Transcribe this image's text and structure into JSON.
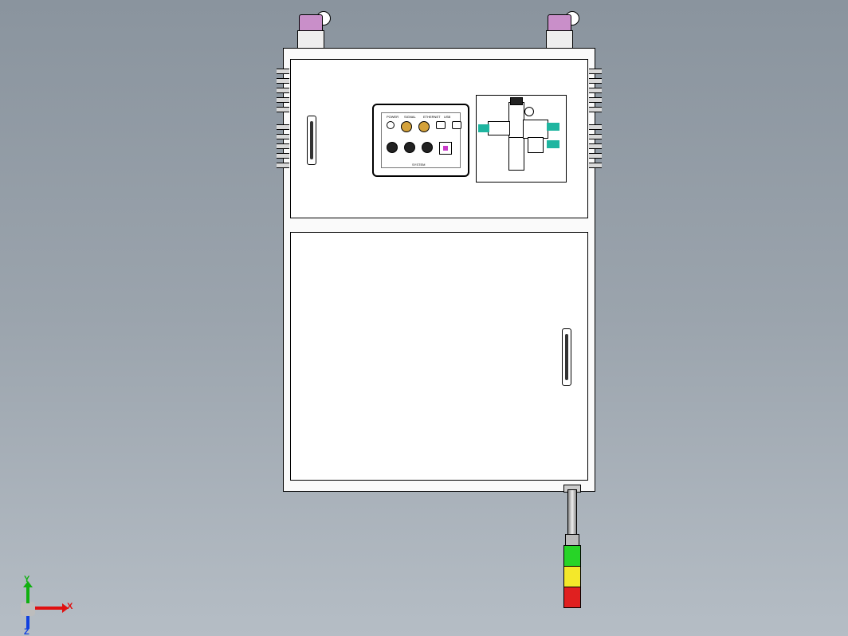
{
  "axes": {
    "x": "X",
    "y": "Y",
    "z": "Z"
  },
  "control_panel": {
    "row1_labels": [
      "POWER",
      "SIGNAL",
      "ETHERNET",
      "USB"
    ],
    "bottom_label": "SYSTEM"
  },
  "signal_tower": {
    "colors": [
      "#27d427",
      "#f4e82a",
      "#e02020"
    ]
  },
  "sensors": {
    "accent": "#c98fc9"
  },
  "pneumatic": {
    "fitting_accent": "#1fb5a0"
  }
}
